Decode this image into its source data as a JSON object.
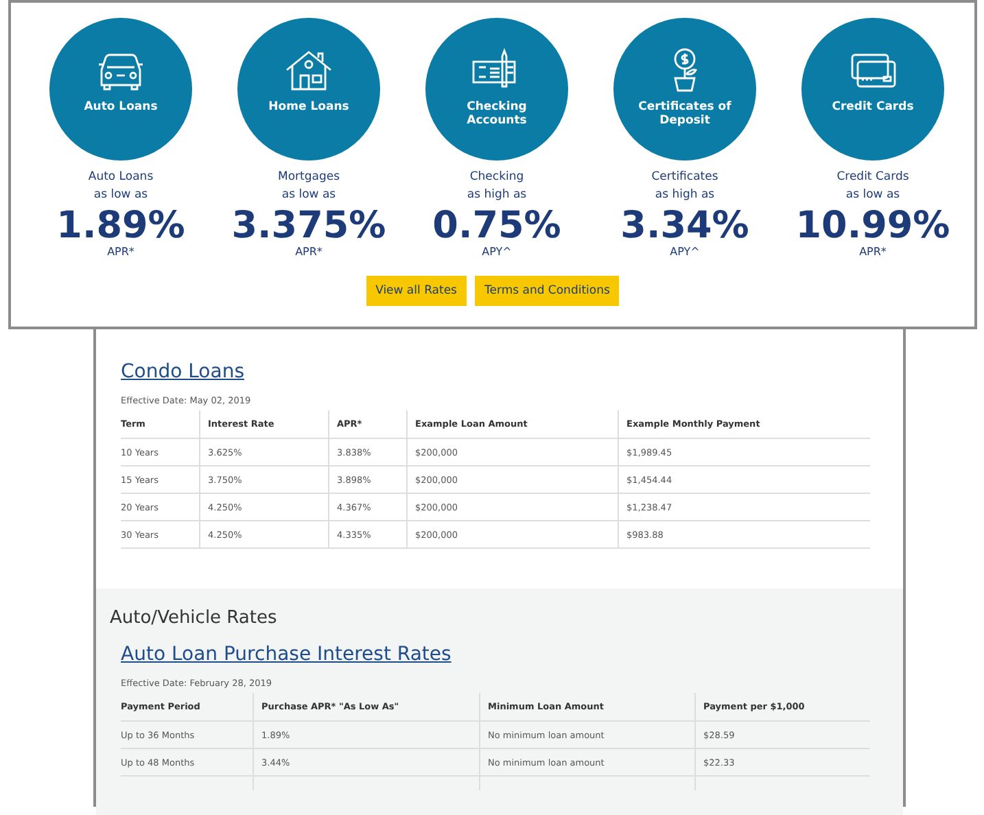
{
  "products": [
    {
      "kind": "car",
      "title": "Auto Loans",
      "caption": [
        "Auto Loans",
        "as low as"
      ],
      "rate": "1.89%",
      "unit": "APR*"
    },
    {
      "kind": "house",
      "title": "Home Loans",
      "caption": [
        "Mortgages",
        "as low as"
      ],
      "rate": "3.375%",
      "unit": "APR*"
    },
    {
      "kind": "check",
      "title": "Checking Accounts",
      "caption": [
        "Checking",
        "as high as"
      ],
      "rate": "0.75%",
      "unit": "APY^"
    },
    {
      "kind": "plant",
      "title": "Certificates of Deposit",
      "caption": [
        "Certificates",
        "as high as"
      ],
      "rate": "3.34%",
      "unit": "APY^"
    },
    {
      "kind": "cards",
      "title": "Credit Cards",
      "caption": [
        "Credit Cards",
        "as low as"
      ],
      "rate": "10.99%",
      "unit": "APR*"
    }
  ],
  "buttons": [
    "View all Rates",
    "Terms and Conditions"
  ],
  "condo": {
    "title": "Condo Loans",
    "effective_date": "Effective Date: May 02, 2019",
    "columns": [
      "Term",
      "Interest Rate",
      "APR*",
      "Example Loan Amount",
      "Example Monthly Payment"
    ],
    "rows": [
      [
        "10 Years",
        "3.625%",
        "3.838%",
        "$200,000",
        "$1,989.45"
      ],
      [
        "15 Years",
        "3.750%",
        "3.898%",
        "$200,000",
        "$1,454.44"
      ],
      [
        "20 Years",
        "4.250%",
        "4.367%",
        "$200,000",
        "$1,238.47"
      ],
      [
        "30 Years",
        "4.250%",
        "4.335%",
        "$200,000",
        "$983.88"
      ]
    ]
  },
  "auto": {
    "section_title": "Auto/Vehicle Rates",
    "title": "Auto Loan Purchase Interest Rates",
    "effective_date": "Effective Date: February 28, 2019",
    "columns": [
      "Payment Period",
      "Purchase APR* \"As Low As\"",
      "Minimum Loan Amount",
      "Payment per $1,000"
    ],
    "rows": [
      [
        "Up to 36 Months",
        "1.89%",
        "No minimum loan amount",
        "$28.59"
      ],
      [
        "Up to 48 Months",
        "3.44%",
        "No minimum loan amount",
        "$22.33"
      ]
    ]
  }
}
